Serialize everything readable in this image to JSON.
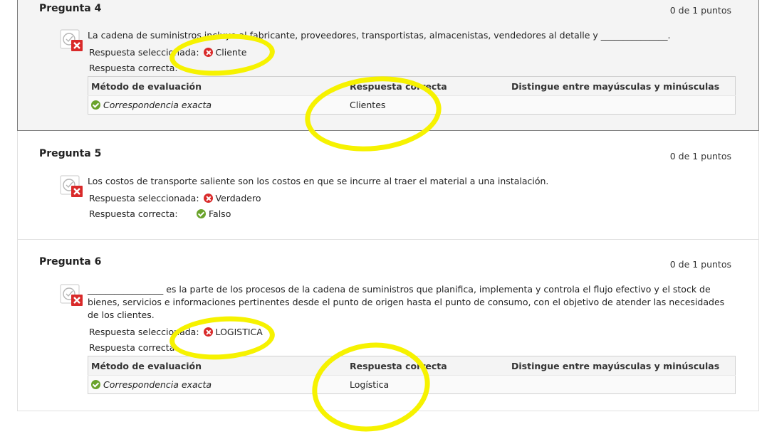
{
  "questions": [
    {
      "title": "Pregunta 4",
      "points": "0 de 1 puntos",
      "text": "La cadena de suministros incluye al fabricante, proveedores, transportistas, almacenistas, vendedores al detalle y _______________.",
      "selected_label": "Respuesta seleccionada:",
      "selected_value": "Cliente",
      "correct_label": "Respuesta correcta:",
      "table": {
        "headers": [
          "Método de evaluación",
          "Respuesta correcta",
          "Distingue entre mayúsculas y minúsculas"
        ],
        "method": "Correspondencia exacta",
        "answer": "Clientes"
      }
    },
    {
      "title": "Pregunta 5",
      "points": "0 de 1 puntos",
      "text": "Los costos de transporte saliente son los costos en que se incurre al traer el material a una instalación.",
      "selected_label": "Respuesta seleccionada:",
      "selected_value": "Verdadero",
      "correct_label": "Respuesta correcta:",
      "correct_value": "Falso"
    },
    {
      "title": "Pregunta 6",
      "points": "0 de 1 puntos",
      "text": "_________________ es la parte de los procesos de la cadena de suministros que planifica, implementa y controla el flujo efectivo y el stock de bienes, servicios e informaciones pertinentes desde el punto de origen hasta el punto de consumo, con el objetivo de atender las necesidades de los clientes.",
      "selected_label": "Respuesta seleccionada:",
      "selected_value": "LOGISTICA",
      "correct_label": "Respuesta correcta:",
      "table": {
        "headers": [
          "Método de evaluación",
          "Respuesta correcta",
          "Distingue entre mayúsculas y minúsculas"
        ],
        "method": "Correspondencia exacta",
        "answer": "Logística"
      }
    }
  ],
  "colors": {
    "highlight": "#f6f200",
    "incorrect": "#d92a2a",
    "correct": "#6aa32b"
  },
  "icons": {
    "question_status": "incorrect-question-icon",
    "wrong": "x-circle-icon",
    "right": "check-circle-icon"
  }
}
